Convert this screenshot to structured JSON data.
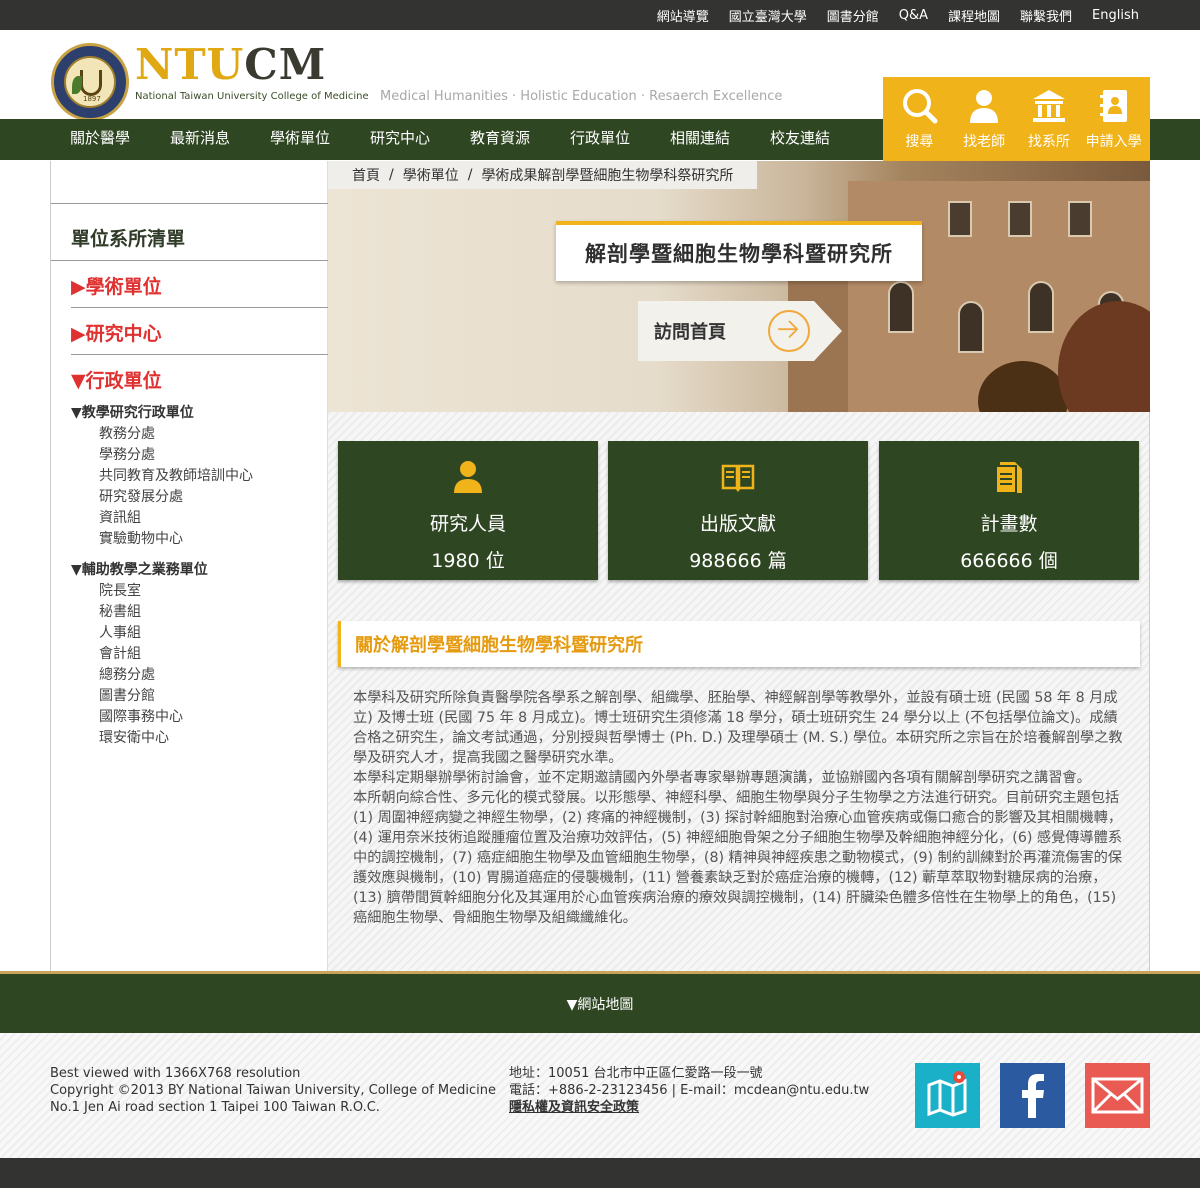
{
  "topbar": {
    "links": [
      "網站導覽",
      "國立臺灣大學",
      "圖書分館",
      "Q&A",
      "課程地圖",
      "聯繫我們",
      "English"
    ]
  },
  "header": {
    "logo_text_a": "NTU",
    "logo_text_b": "CM",
    "logo_subtitle": "National Taiwan University College of Medicine",
    "tagline": "Medical Humanities · Holistic Education · Resaerch Excellence",
    "seal_year": "1897"
  },
  "quick_links": [
    {
      "label": "搜尋",
      "icon": "search-icon"
    },
    {
      "label": "找老師",
      "icon": "person-icon"
    },
    {
      "label": "找系所",
      "icon": "institution-icon"
    },
    {
      "label": "申請入學",
      "icon": "address-book-icon"
    }
  ],
  "main_nav": [
    "關於醫學院",
    "最新消息",
    "學術單位",
    "研究中心",
    "教育資源",
    "行政單位",
    "相關連結",
    "校友連結"
  ],
  "sidebar": {
    "title": "單位系所清單",
    "sections": [
      "▶學術單位",
      "▶研究中心",
      "▼行政單位"
    ],
    "groups": [
      {
        "heading": "▼教學研究行政單位",
        "items": [
          "教務分處",
          "學務分處",
          "共同教育及教師培訓中心",
          "研究發展分處",
          "資訊組",
          "實驗動物中心"
        ]
      },
      {
        "heading": "▼輔助教學之業務單位",
        "items": [
          "院長室",
          "秘書組",
          "人事組",
          "會計組",
          "總務分處",
          "圖書分館",
          "國際事務中心",
          "環安衛中心"
        ]
      }
    ]
  },
  "breadcrumb": [
    "首頁",
    "學術單位",
    "學術成果解剖學暨細胞生物學科祭研究所"
  ],
  "unit_title": "解剖學暨細胞生物學科暨研究所",
  "visit_label": "訪問首頁",
  "stats": [
    {
      "label": "研究人員",
      "value": "1980 位",
      "icon": "person-icon"
    },
    {
      "label": "出版文獻",
      "value": "988666 篇",
      "icon": "book-icon"
    },
    {
      "label": "計畫數",
      "value": "666666 個",
      "icon": "document-icon"
    }
  ],
  "about": {
    "title": "關於解剖學暨細胞生物學科暨研究所",
    "paragraphs": [
      "本學科及研究所除負責醫學院各學系之解剖學、組織學、胚胎學、神經解剖學等教學外，並設有碩士班 (民國 58 年 8 月成立) 及博士班 (民國 75 年 8 月成立)。博士班研究生須修滿 18 學分，碩士班研究生 24 學分以上 (不包括學位論文)。成績合格之研究生，論文考試通過，分別授與哲學博士 (Ph. D.) 及理學碩士 (M. S.) 學位。本研究所之宗旨在於培養解剖學之教學及研究人才，提高我國之醫學研究水準。",
      "本學科定期舉辦學術討論會，並不定期邀請國內外學者專家舉辦專題演講，並協辦國內各項有關解剖學研究之講習會。",
      "本所朝向綜合性、多元化的模式發展。以形態學、神經科學、細胞生物學與分子生物學之方法進行研究。目前研究主題包括 (1) 周圍神經病變之神經生物學，(2) 疼痛的神經機制，(3) 探討幹細胞對治療心血管疾病或傷口癒合的影響及其相關機轉，(4) 運用奈米技術追蹤腫瘤位置及治療功效評估，(5) 神經細胞骨架之分子細胞生物學及幹細胞神經分化，(6) 感覺傳導體系中的調控機制，(7) 癌症細胞生物學及血管細胞生物學，(8) 精神與神經疾患之動物模式，(9) 制約訓練對於再灌流傷害的保護效應與機制，(10) 胃腸道癌症的侵襲機制，(11) 營養素缺乏對於癌症治療的機轉，(12) 蘄草萃取物對糖尿病的治療，(13) 臍帶間質幹細胞分化及其運用於心血管疾病治療的療效與調控機制，(14) 肝臟染色體多倍性在生物學上的角色，(15)癌細胞生物學、骨細胞生物學及組織纖維化。"
    ]
  },
  "footer": {
    "sitemap": "▼網站地圖",
    "left_lines": [
      "Best viewed with 1366X768 resolution",
      "Copyright ©2013 BY National Taiwan University, College of Medicine",
      "No.1 Jen Ai road section 1 Taipei 100 Taiwan R.O.C."
    ],
    "mid_lines": [
      "地址：10051 台北市中正區仁愛路一段一號",
      "電話：+886-2-23123456 | E-mail：mcdean@ntu.edu.tw"
    ],
    "policy_link": "隱私權及資訊安全政策",
    "social_icons": [
      "map-icon",
      "facebook-icon",
      "mail-icon"
    ]
  },
  "colors": {
    "nav_green": "#2f4623",
    "accent_yellow": "#f0b31a",
    "sidebar_red": "#e03131",
    "topbar": "#333331"
  }
}
